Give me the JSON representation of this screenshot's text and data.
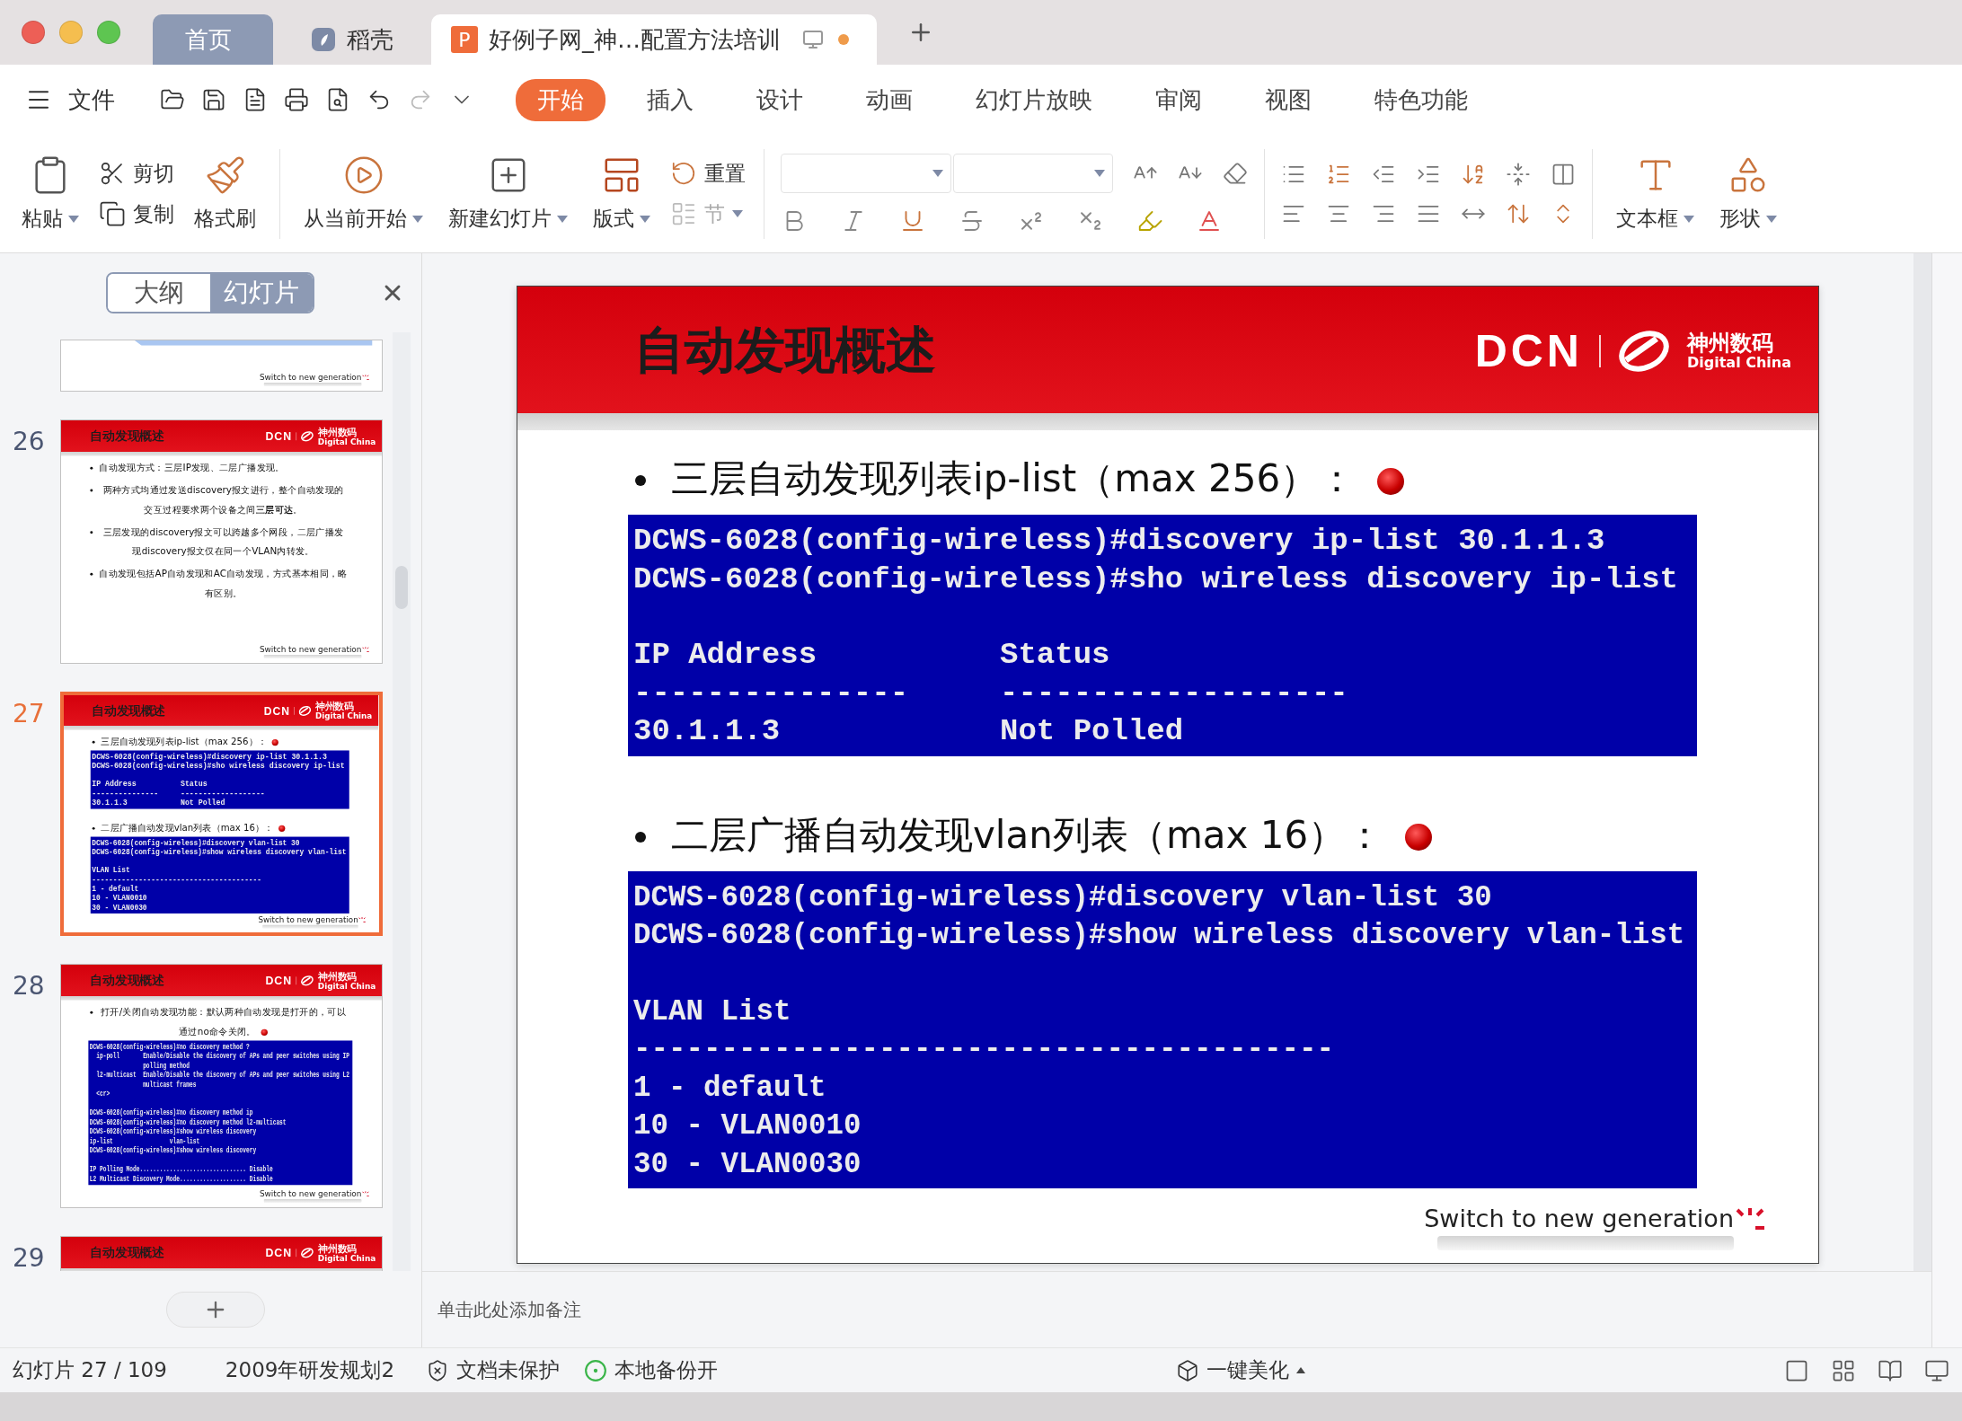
{
  "title_bar": {
    "tabs": [
      {
        "label": "首页",
        "kind": "home",
        "selected": false
      },
      {
        "label": "稻壳",
        "kind": "docer",
        "selected": false
      },
      {
        "label": "好例子网_神…配置方法培训",
        "kind": "document",
        "icon_letter": "P",
        "selected": true,
        "unsaved": true
      }
    ]
  },
  "menu": {
    "file": "文件",
    "tabs": [
      {
        "label": "开始",
        "selected": true
      },
      {
        "label": "插入",
        "selected": false
      },
      {
        "label": "设计",
        "selected": false
      },
      {
        "label": "动画",
        "selected": false
      },
      {
        "label": "幻灯片放映",
        "selected": false
      },
      {
        "label": "审阅",
        "selected": false
      },
      {
        "label": "视图",
        "selected": false
      },
      {
        "label": "特色功能",
        "selected": false
      }
    ]
  },
  "ribbon": {
    "paste": {
      "label": "粘贴",
      "menu": true
    },
    "cut": {
      "label": "剪切"
    },
    "copy": {
      "label": "复制"
    },
    "format_painter": {
      "label": "格式刷"
    },
    "play_from_current": {
      "label": "从当前开始",
      "menu": true
    },
    "new_slide": {
      "label": "新建幻灯片",
      "menu": true
    },
    "layout": {
      "label": "版式",
      "menu": true
    },
    "reset": {
      "label": "重置"
    },
    "section": {
      "label": "节",
      "menu": true,
      "disabled": true
    },
    "text_box": {
      "label": "文本框",
      "menu": true
    },
    "shape": {
      "label": "形状",
      "menu": true
    }
  },
  "panel": {
    "views": [
      {
        "label": "大纲",
        "selected": false
      },
      {
        "label": "幻灯片",
        "selected": true
      }
    ],
    "thumbnails": [
      {
        "selected": false,
        "slide": {
          "sections": [
            {
              "kind": "shape"
            }
          ],
          "footer": "Switch to new generation"
        }
      },
      {
        "number": "26",
        "selected": false,
        "slide": {
          "title": "自动发现概述",
          "logo": {
            "wordmark": "DCN",
            "name": "神州数码",
            "name_en": "Digital China"
          },
          "sections": [
            {
              "kind": "bullet",
              "text": "自动发现方式：三层IP发现、二层广播发现。",
              "dot": false
            },
            {
              "kind": "bullet",
              "text": "两种方式均通过发送discovery报文进行，整个自动发现的交互过程要求两个设备之间**三层可达**。",
              "dot": false
            },
            {
              "kind": "bullet",
              "text": "三层发现的discovery报文可以跨越多个网段，二层广播发现discovery报文仅在同一个VLAN内转发。",
              "dot": false
            },
            {
              "kind": "bullet",
              "text": "自动发现包括AP自动发现和AC自动发现，方式基本相同，略有区别。",
              "dot": false
            }
          ],
          "footer": "Switch to new generation"
        }
      },
      {
        "number": "27",
        "selected": true,
        "slide": {
          "title": "自动发现概述",
          "logo": {
            "wordmark": "DCN",
            "name": "神州数码",
            "name_en": "Digital China"
          },
          "sections": [
            {
              "kind": "bullet",
              "text": "三层自动发现列表ip-list（max 256）：",
              "dot": true
            },
            {
              "kind": "terminal",
              "blocks": [
                [
                  "DCWS-6028(config-wireless)#discovery ip-list 30.1.1.3",
                  "DCWS-6028(config-wireless)#sho wireless discovery ip-list"
                ],
                [
                  "IP Address          Status",
                  "---------------     -------------------",
                  "30.1.1.3            Not Polled"
                ]
              ]
            },
            {
              "kind": "bullet",
              "text": "二层广播自动发现vlan列表（max 16）：",
              "dot": true
            },
            {
              "kind": "terminal",
              "blocks": [
                [
                  "DCWS-6028(config-wireless)#discovery vlan-list 30",
                  "DCWS-6028(config-wireless)#show wireless discovery vlan-list"
                ],
                [
                  "VLAN List",
                  "----------------------------------------",
                  "1 - default",
                  "10 - VLAN0010",
                  "30 - VLAN0030"
                ]
              ]
            }
          ],
          "footer": "Switch to new generation"
        }
      },
      {
        "number": "28",
        "selected": false,
        "slide": {
          "title": "自动发现概述",
          "logo": {
            "wordmark": "DCN",
            "name": "神州数码",
            "name_en": "Digital China"
          },
          "sections": [
            {
              "kind": "bullet",
              "text": "打开/关闭自动发现功能：默认两种自动发现是打开的，可以通过no命令关闭。",
              "dot": true
            },
            {
              "kind": "terminal",
              "blocks": [
                [
                  "DCWS-6028(config-wireless)#no discovery method ?",
                  "  ip-poll       Enable/Disable the discovery of APs and peer switches using IP",
                  "                polling method",
                  "  l2-multicast  Enable/Disable the discovery of APs and peer switches using L2",
                  "                multicast frames",
                  "  <cr>"
                ],
                [
                  "DCWS-6028(config-wireless)#no discovery method ip",
                  "DCWS-6028(config-wireless)#no discovery method l2-multicast",
                  "DCWS-6028(config-wireless)#show wireless discovery",
                  "ip-list                 vlan-list",
                  "DCWS-6028(config-wireless)#show wireless discovery"
                ],
                [
                  "IP Polling Mode................................ Disable",
                  "L2 Multicast Discovery Mode.................... Disable"
                ]
              ]
            }
          ],
          "footer": "Switch to new generation"
        }
      },
      {
        "number": "29",
        "selected": false,
        "slide": {
          "title": "自动发现概述",
          "logo": {
            "wordmark": "DCN",
            "name": "神州数码",
            "name_en": "Digital China"
          }
        }
      }
    ]
  },
  "slide": {
    "title": "自动发现概述",
    "logo": {
      "wordmark": "DCN",
      "name": "神州数码",
      "name_en": "Digital China"
    },
    "sections": [
      {
        "kind": "bullet",
        "text": "三层自动发现列表ip-list（max 256）：",
        "dot": true
      },
      {
        "kind": "terminal",
        "blocks": [
          [
            "DCWS-6028(config-wireless)#discovery ip-list 30.1.1.3",
            "DCWS-6028(config-wireless)#sho wireless discovery ip-list"
          ],
          [
            "IP Address          Status",
            "---------------     -------------------",
            "30.1.1.3            Not Polled"
          ]
        ]
      },
      {
        "kind": "bullet",
        "text": "二层广播自动发现vlan列表（max 16）：",
        "dot": true
      },
      {
        "kind": "terminal",
        "blocks": [
          [
            "DCWS-6028(config-wireless)#discovery vlan-list 30",
            "DCWS-6028(config-wireless)#show wireless discovery vlan-list"
          ],
          [
            "VLAN List",
            "----------------------------------------",
            "1 - default",
            "10 - VLAN0010",
            "30 - VLAN0030"
          ]
        ]
      }
    ],
    "footer": "Switch to new generation"
  },
  "notes": {
    "placeholder": "单击此处添加备注"
  },
  "status_bar": {
    "slide_counter": "幻灯片 27 / 109",
    "theme": "2009年研发规划2",
    "protection": "文档未保护",
    "backup": "本地备份开",
    "beautify": "一键美化"
  }
}
